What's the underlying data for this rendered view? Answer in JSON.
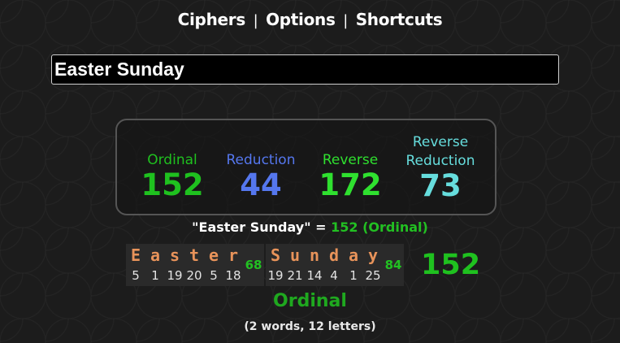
{
  "nav": {
    "ciphers": "Ciphers",
    "options": "Options",
    "shortcuts": "Shortcuts",
    "separator": "|"
  },
  "phrase": {
    "value": "Easter Sunday"
  },
  "ciphers": [
    {
      "name": "Ordinal",
      "value": "152"
    },
    {
      "name": "Reduction",
      "value": "44"
    },
    {
      "name": "Reverse",
      "value": "172"
    },
    {
      "name_line1": "Reverse",
      "name_line2": "Reduction",
      "value": "73"
    }
  ],
  "summary": {
    "phrase_quoted": "\"Easter Sunday\"",
    "equals": "=",
    "result": "152 (Ordinal)"
  },
  "breakdown": {
    "words": [
      {
        "letters": [
          "E",
          "a",
          "s",
          "t",
          "e",
          "r"
        ],
        "values": [
          "5",
          "1",
          "19",
          "20",
          "5",
          "18"
        ],
        "sum": "68"
      },
      {
        "letters": [
          "S",
          "u",
          "n",
          "d",
          "a",
          "y"
        ],
        "values": [
          "19",
          "21",
          "14",
          "4",
          "1",
          "25"
        ],
        "sum": "84"
      }
    ],
    "total": "152",
    "cipher_name": "Ordinal",
    "counts": "(2 words, 12 letters)"
  },
  "colors": {
    "ordinal": "#1fc11f",
    "reduction": "#5577ee",
    "reverse": "#2fe02f",
    "reverse_reduction": "#66dddd",
    "letter": "#e8935a",
    "background": "#1c1c1c"
  }
}
